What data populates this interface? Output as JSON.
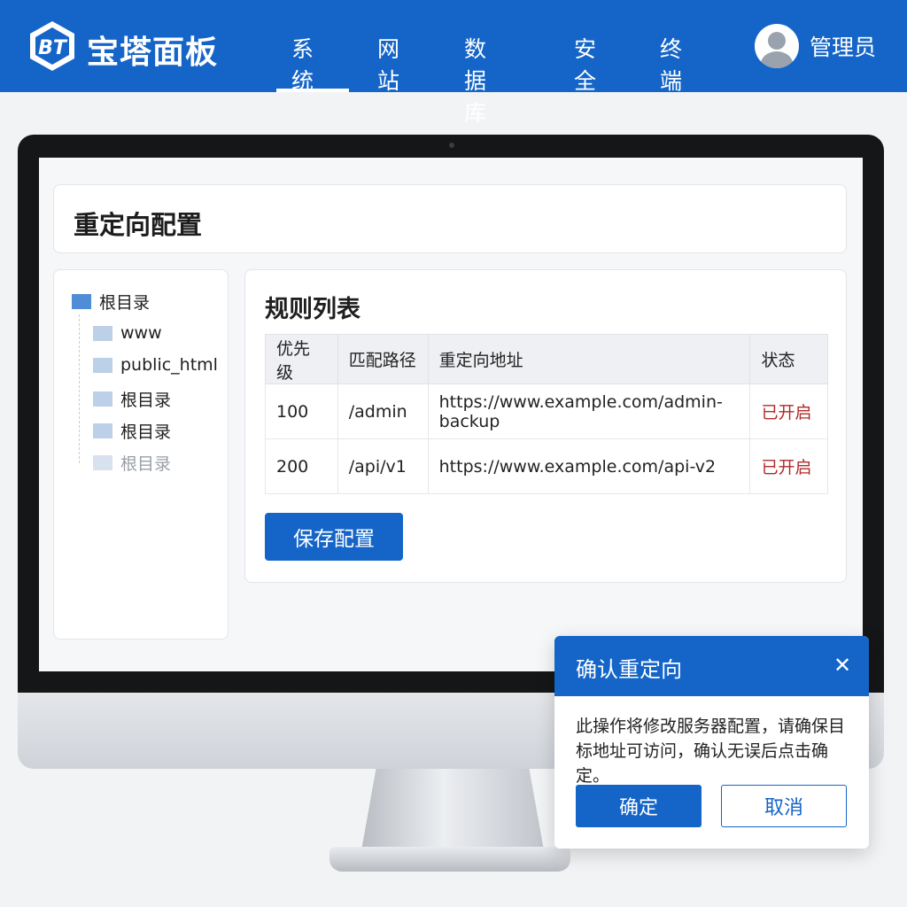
{
  "colors": {
    "brand": "#1565c8",
    "status_enabled": "#b02a2a",
    "background": "#f2f3f5"
  },
  "header": {
    "logo_text": "BT",
    "brand_name": "宝塔面板",
    "nav": [
      {
        "label": "系统",
        "active": true
      },
      {
        "label": "网站",
        "active": false
      },
      {
        "label": "数据库",
        "active": false
      },
      {
        "label": "安全",
        "active": false
      },
      {
        "label": "终端",
        "active": false
      }
    ],
    "user": {
      "name": "管理员",
      "icon": "avatar-icon"
    }
  },
  "page": {
    "title": "重定向配置"
  },
  "tree": {
    "root": {
      "label": "根目录",
      "icon": "folder-icon"
    },
    "items": [
      {
        "label": "www",
        "icon": "folder-icon"
      },
      {
        "label": "public_html",
        "icon": "folder-icon"
      },
      {
        "label": "根目录",
        "icon": "folder-icon"
      },
      {
        "label": "根目录",
        "icon": "folder-icon"
      },
      {
        "label": "根目录",
        "icon": "folder-icon"
      }
    ]
  },
  "rules": {
    "title": "规则列表",
    "columns": [
      "优先级",
      "匹配路径",
      "重定向地址",
      "状态"
    ],
    "rows": [
      {
        "priority": "100",
        "path": "/admin",
        "target": "https://www.example.com/admin-backup",
        "status": "已开启"
      },
      {
        "priority": "200",
        "path": "/api/v1",
        "target": "https://www.example.com/api-v2",
        "status": "已开启"
      }
    ],
    "save_label": "保存配置"
  },
  "dialog": {
    "title": "确认重定向",
    "close_icon": "close-icon",
    "message": "此操作将修改服务器配置，请确保目标地址可访问，确认无误后点击确定。",
    "ok_label": "确定",
    "cancel_label": "取消"
  }
}
